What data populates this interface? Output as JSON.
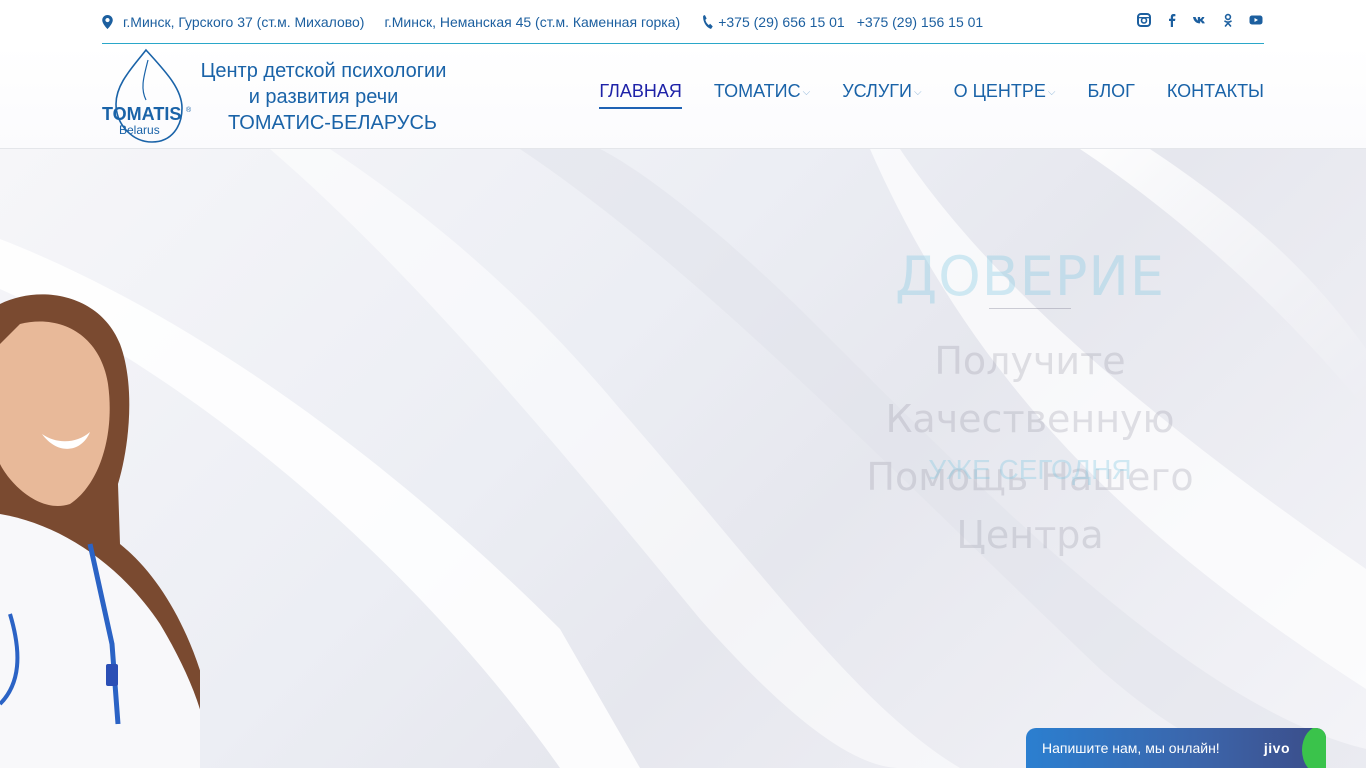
{
  "topbar": {
    "address1": "г.Минск, Гурского 37 (ст.м. Михалово)",
    "address2": "г.Минск, Неманская 45 (ст.м. Каменная горка)",
    "phone1": "+375 (29) 656 15 01",
    "phone2": "+375 (29) 156 15 01",
    "social": [
      "instagram-icon",
      "facebook-icon",
      "vk-icon",
      "odnoklassniki-icon",
      "youtube-icon"
    ]
  },
  "header": {
    "logo_text": "TOMATIS",
    "logo_sub": "Belarus",
    "brand_line1": "Центр детской психологии",
    "brand_line2": "и развития речи",
    "brand_line3": "ТОМАТИС-БЕЛАРУСЬ"
  },
  "nav": {
    "items": [
      {
        "label": "ГЛАВНАЯ",
        "active": true
      },
      {
        "label": "ТОМАТИС",
        "dropdown": true
      },
      {
        "label": "УСЛУГИ",
        "dropdown": true
      },
      {
        "label": "О ЦЕНТРЕ",
        "dropdown": true
      },
      {
        "label": "БЛОГ"
      },
      {
        "label": "КОНТАКТЫ"
      }
    ]
  },
  "hero": {
    "title": "ДОВЕРИЕ",
    "subtitle_line1": "Получите Качественную",
    "subtitle_line2": "Помощь Нашего Центра",
    "cta": "УЖЕ СЕГОДНЯ"
  },
  "chat": {
    "label": "Напишите нам, мы онлайн!",
    "brand": "jivo"
  },
  "colors": {
    "primary": "#1a63a8",
    "accent_line": "#2aa7c9",
    "active_nav": "#1e22a8",
    "chat_online": "#3ac34b"
  }
}
